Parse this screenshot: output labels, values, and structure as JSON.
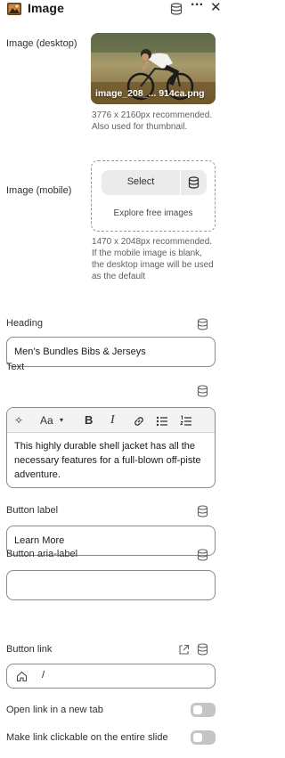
{
  "header": {
    "title": "Image",
    "more_glyph": "···",
    "close_glyph": "✕",
    "icons": [
      "image-block-icon",
      "dynamic-source-icon",
      "more-icon",
      "close-icon"
    ]
  },
  "image_desktop": {
    "label": "Image (desktop)",
    "filename": "image_208_... 914ca.png",
    "hint": "3776 x 2160px recommended. Also used for thumbnail."
  },
  "image_mobile": {
    "label": "Image (mobile)",
    "select_label": "Select",
    "explore_label": "Explore free images",
    "hint": "1470 x 2048px recommended. If the mobile image is blank, the desktop image will be used as the default"
  },
  "heading": {
    "label": "Heading",
    "value": "Men’s Bundles Bibs & Jerseys"
  },
  "text": {
    "label": "Text",
    "toolbar": {
      "ai": "✧",
      "font": "Aa",
      "bold": "B",
      "italic": "I"
    },
    "value": "This highly durable shell jacket has all the necessary features for a full-blown off-piste adventure."
  },
  "button_label": {
    "label": "Button label",
    "value": "Learn More"
  },
  "button_aria": {
    "label": "Button aria-label",
    "value": ""
  },
  "button_link": {
    "label": "Button link",
    "value": "/"
  },
  "toggles": {
    "new_tab": {
      "label": "Open link in a new tab",
      "on": false
    },
    "clickable_slide": {
      "label": "Make link clickable on the entire slide",
      "on": false
    }
  },
  "colors": {
    "border": "#8a8a8a",
    "toggle_off": "#c4c4c4",
    "text": "#303030",
    "hint": "#616161"
  }
}
